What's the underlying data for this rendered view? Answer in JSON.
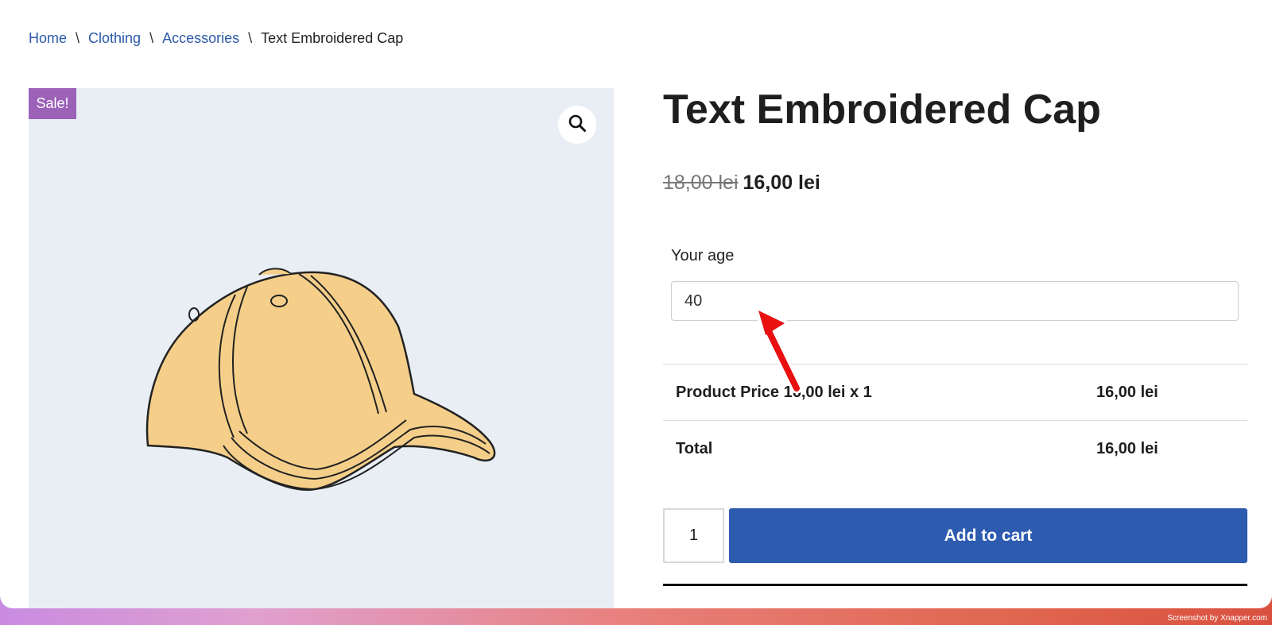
{
  "breadcrumb": {
    "items": [
      "Home",
      "Clothing",
      "Accessories"
    ],
    "separator": "\\",
    "current": "Text Embroidered Cap"
  },
  "gallery": {
    "sale_badge": "Sale!",
    "zoom_icon": "search-icon",
    "image": "cap-illustration"
  },
  "product": {
    "title": "Text Embroidered Cap",
    "regular_price": "18,00 lei",
    "sale_price": "16,00 lei"
  },
  "addon": {
    "label": "Your age",
    "value": "40"
  },
  "totals": {
    "rows": [
      {
        "label": "Product Price 16,00 lei x 1",
        "value": "16,00 lei"
      },
      {
        "label": "Total",
        "value": "16,00 lei"
      }
    ]
  },
  "cart": {
    "quantity": "1",
    "add_label": "Add to cart"
  },
  "footer": {
    "credit": "Screenshot by Xnapper.com"
  },
  "colors": {
    "link": "#2c5aa8",
    "sale_badge": "#9b62b8",
    "button": "#2d5bb0",
    "annotation_arrow": "#e81010"
  }
}
